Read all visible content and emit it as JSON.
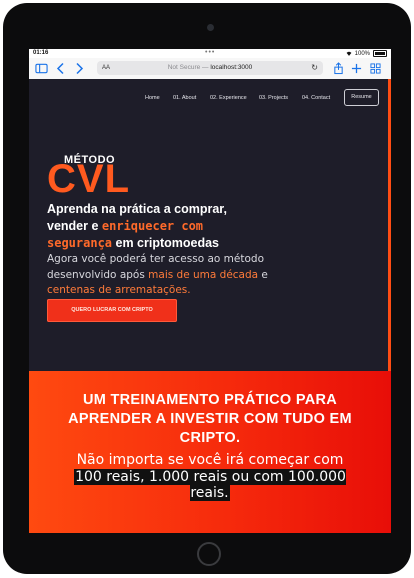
{
  "status_bar": {
    "time": "01:16",
    "battery": "100%"
  },
  "browser": {
    "text_size_label": "AA",
    "url_insecure": "Not Secure —",
    "url_host": "localhost:3000"
  },
  "nav": {
    "links": [
      "Home",
      "01. About",
      "02. Experience",
      "03. Projects",
      "04. Contact"
    ],
    "resume_label": "Resume"
  },
  "hero": {
    "eyebrow": "MÉTODO",
    "brand": "CVL",
    "headline_1": "Aprenda na prática a comprar, vender e ",
    "headline_hl1": "enriquecer com segurança",
    "headline_2": " em criptomoedas",
    "body_1": "Agora você poderá ter acesso ao método desenvolvido após ",
    "body_hl1": "mais de uma década",
    "body_2": " e ",
    "body_hl2": "centenas de arrematações.",
    "cta_label": "QUERO LUCRAR COM CRIPTO"
  },
  "promo": {
    "title": "UM TREINAMENTO PRÁTICO PARA APRENDER A INVESTIR COM TUDO EM CRIPTO.",
    "subtitle_1": "Não importa se você irá começar com",
    "subtitle_hl": "100 reais, 1.000 reais ou com 100.000 reais."
  },
  "colors": {
    "accent": "#ff5a1f",
    "hero_background": "#1e1d29",
    "cta": "#f0301a",
    "promo_gradient_start": "#ff4a10",
    "promo_gradient_end": "#e80e08"
  },
  "icons": [
    "sidebar-icon",
    "back-icon",
    "forward-icon",
    "reload-icon",
    "share-icon",
    "new-tab-icon",
    "tabs-icon",
    "wifi-icon",
    "battery-icon"
  ]
}
